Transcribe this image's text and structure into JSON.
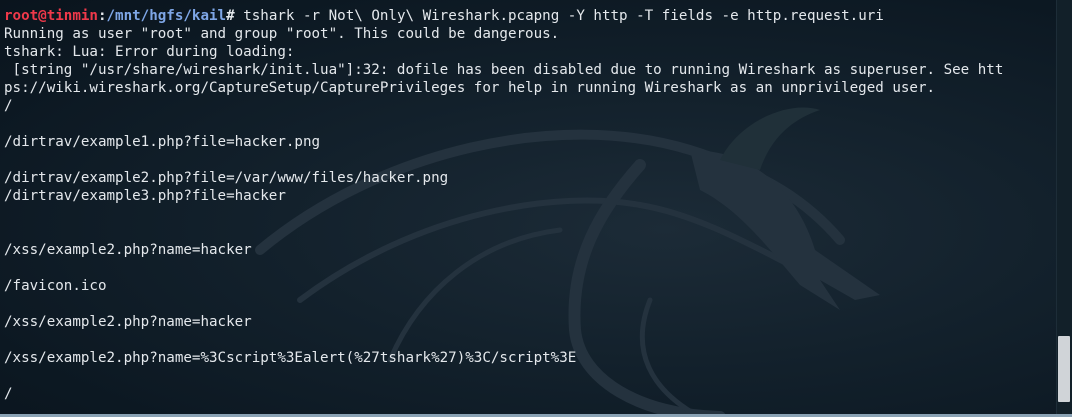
{
  "prompt": {
    "user_host": "root@tinmin",
    "separator": ":",
    "path": "/mnt/hgfs/kail",
    "symbol": "#",
    "command": " tshark -r Not\\ Only\\ Wireshark.pcapng -Y http -T fields -e http.request.uri"
  },
  "output_lines": [
    "Running as user \"root\" and group \"root\". This could be dangerous.",
    "tshark: Lua: Error during loading:",
    " [string \"/usr/share/wireshark/init.lua\"]:32: dofile has been disabled due to running Wireshark as superuser. See htt",
    "ps://wiki.wireshark.org/CaptureSetup/CapturePrivileges for help in running Wireshark as an unprivileged user.",
    "/",
    "",
    "/dirtrav/example1.php?file=hacker.png",
    "",
    "/dirtrav/example2.php?file=/var/www/files/hacker.png",
    "/dirtrav/example3.php?file=hacker",
    "",
    "",
    "/xss/example2.php?name=hacker",
    "",
    "/favicon.ico",
    "",
    "/xss/example2.php?name=hacker",
    "",
    "/xss/example2.php?name=%3Cscript%3Ealert(%27tshark%27)%3C/script%3E",
    "",
    "/"
  ],
  "colors": {
    "user_host": "#f0394a",
    "path": "#7ea6e6",
    "text": "#e4e8ec",
    "background": "#12202b"
  }
}
